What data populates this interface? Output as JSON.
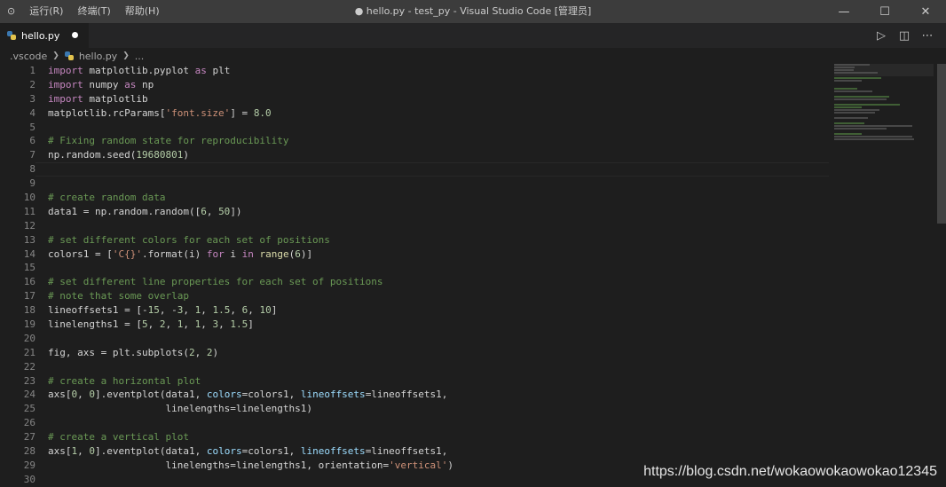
{
  "menu": [
    "运行(R)",
    "终端(T)",
    "帮助(H)"
  ],
  "window_title": "● hello.py - test_py - Visual Studio Code [管理员]",
  "window_controls": {
    "minimize": "—",
    "maximize": "☐",
    "close": "✕"
  },
  "tab": {
    "label": "hello.py",
    "dirty": true
  },
  "tab_actions": {
    "run": "▷",
    "split": "◫",
    "more": "⋯"
  },
  "breadcrumb": {
    "folder": ".vscode",
    "file": "hello.py",
    "more": "..."
  },
  "line_numbers": [
    "1",
    "2",
    "3",
    "4",
    "5",
    "6",
    "7",
    "8",
    "9",
    "10",
    "11",
    "12",
    "13",
    "14",
    "15",
    "16",
    "17",
    "18",
    "19",
    "20",
    "21",
    "22",
    "23",
    "24",
    "25",
    "26",
    "27",
    "28",
    "29",
    "30"
  ],
  "code_lines": [
    "import matplotlib.pyplot as plt",
    "import numpy as np",
    "import matplotlib",
    "matplotlib.rcParams['font.size'] = 8.0",
    "",
    "# Fixing random state for reproducibility",
    "np.random.seed(19680801)",
    "",
    "",
    "# create random data",
    "data1 = np.random.random([6, 50])",
    "",
    "# set different colors for each set of positions",
    "colors1 = ['C{}'.format(i) for i in range(6)]",
    "",
    "# set different line properties for each set of positions",
    "# note that some overlap",
    "lineoffsets1 = [-15, -3, 1, 1.5, 6, 10]",
    "linelengths1 = [5, 2, 1, 1, 3, 1.5]",
    "",
    "fig, axs = plt.subplots(2, 2)",
    "",
    "# create a horizontal plot",
    "axs[0, 0].eventplot(data1, colors=colors1, lineoffsets=lineoffsets1,",
    "                    linelengths=linelengths1)",
    "",
    "# create a vertical plot",
    "axs[1, 0].eventplot(data1, colors=colors1, lineoffsets=lineoffsets1,",
    "                    linelengths=linelengths1, orientation='vertical')",
    ""
  ],
  "watermark": "https://blog.csdn.net/wokaowokaowokao12345"
}
